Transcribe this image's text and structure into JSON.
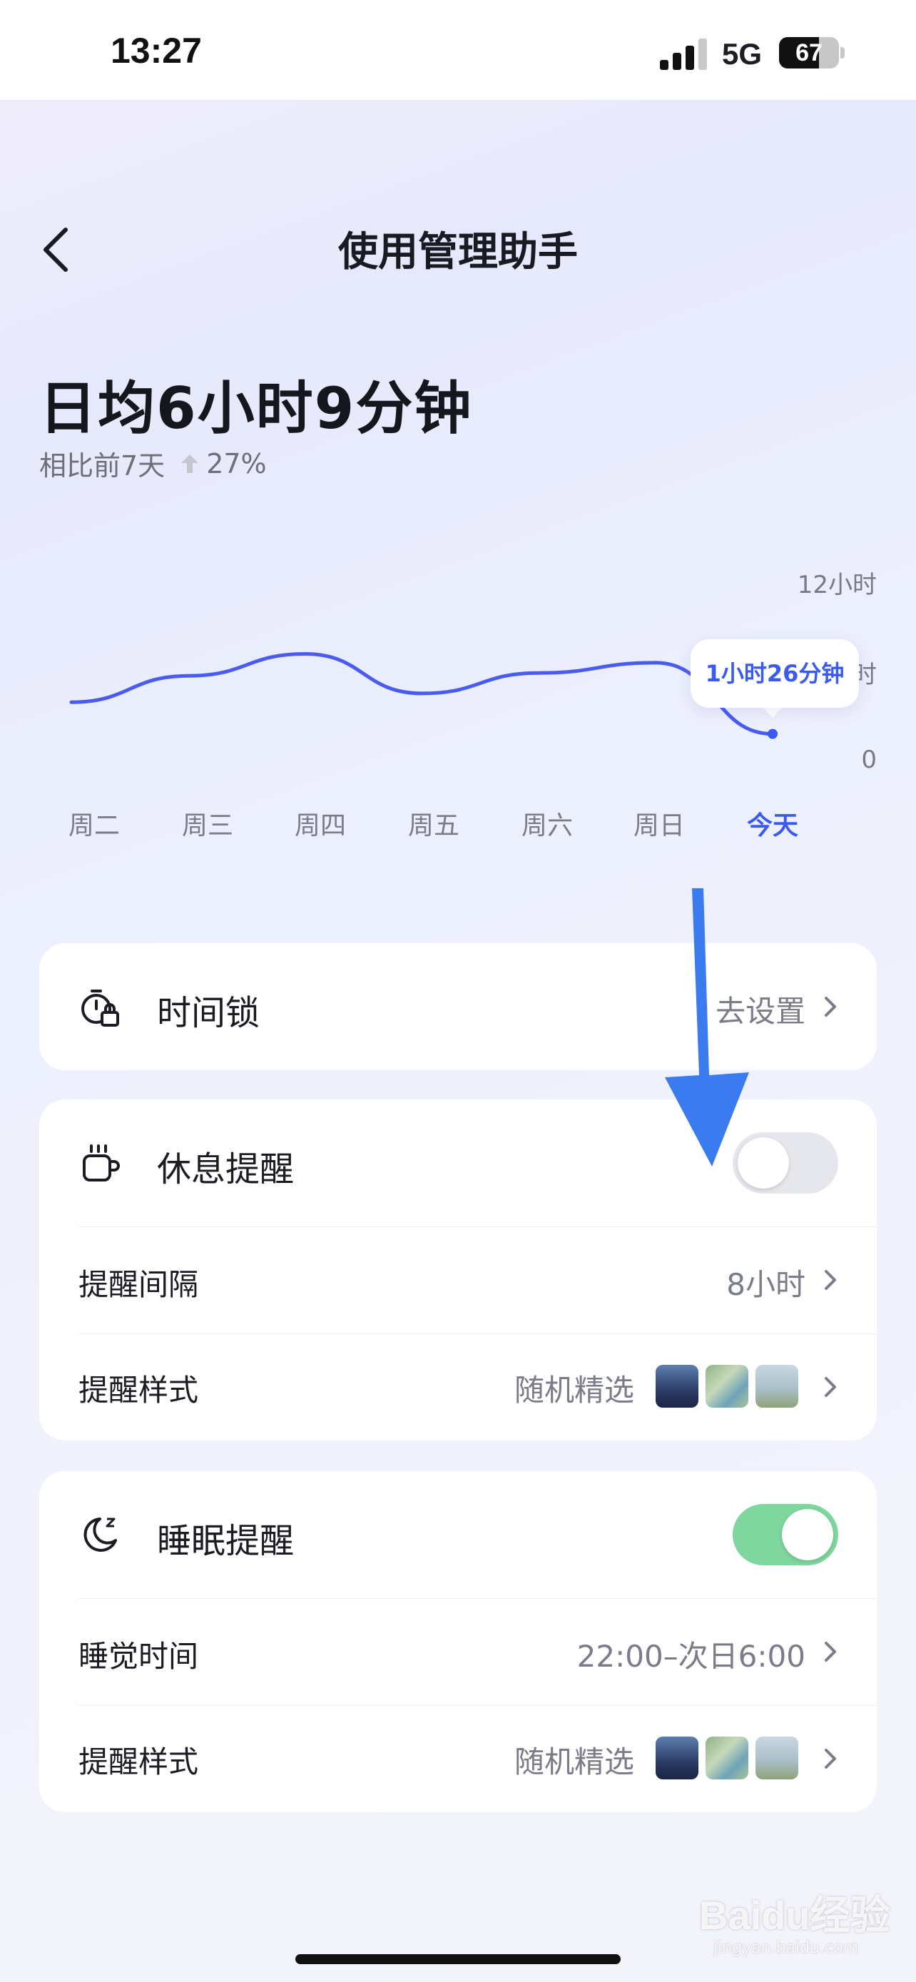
{
  "status_bar": {
    "time": "13:27",
    "network": "5G",
    "battery_percent": "67",
    "battery_level": 0.67,
    "signal_bars_active": 3
  },
  "header": {
    "title": "使用管理助手",
    "back_icon": "chevron-left-icon"
  },
  "summary": {
    "daily_average": "日均6小时9分钟",
    "compare_label": "相比前7天",
    "compare_icon": "arrow-up-icon",
    "compare_value": "27%"
  },
  "chart_data": {
    "type": "line",
    "categories": [
      "周二",
      "周三",
      "周四",
      "周五",
      "周六",
      "周日",
      "今天"
    ],
    "values": [
      3.6,
      5.4,
      6.9,
      4.2,
      5.6,
      6.3,
      1.43
    ],
    "y_ticks": [
      "12小时",
      "6小时",
      "0"
    ],
    "ylim": [
      0,
      12
    ],
    "highlight_index": 6,
    "tooltip": "1小时26分钟",
    "line_color": "#4a5cf0",
    "highlight_color": "#3b5bf0",
    "grid": false
  },
  "time_lock": {
    "icon": "stopwatch-lock-icon",
    "title": "时间锁",
    "action": "去设置"
  },
  "rest_reminder": {
    "icon": "coffee-cup-icon",
    "title": "休息提醒",
    "enabled": false,
    "interval_label": "提醒间隔",
    "interval_value": "8小时",
    "style_label": "提醒样式",
    "style_value": "随机精选"
  },
  "sleep_reminder": {
    "icon": "moon-zz-icon",
    "title": "睡眠提醒",
    "enabled": true,
    "time_label": "睡觉时间",
    "time_value": "22:00–次日6:00",
    "style_label": "提醒样式",
    "style_value": "随机精选"
  },
  "colors": {
    "toggle_on": "#7fd69e",
    "toggle_off": "#e6e7ec",
    "accent": "#3b5bf0",
    "annotation_arrow": "#3a7bf0"
  },
  "watermark": {
    "brand": "Baidu经验",
    "url": "jingyan.baidu.com"
  }
}
